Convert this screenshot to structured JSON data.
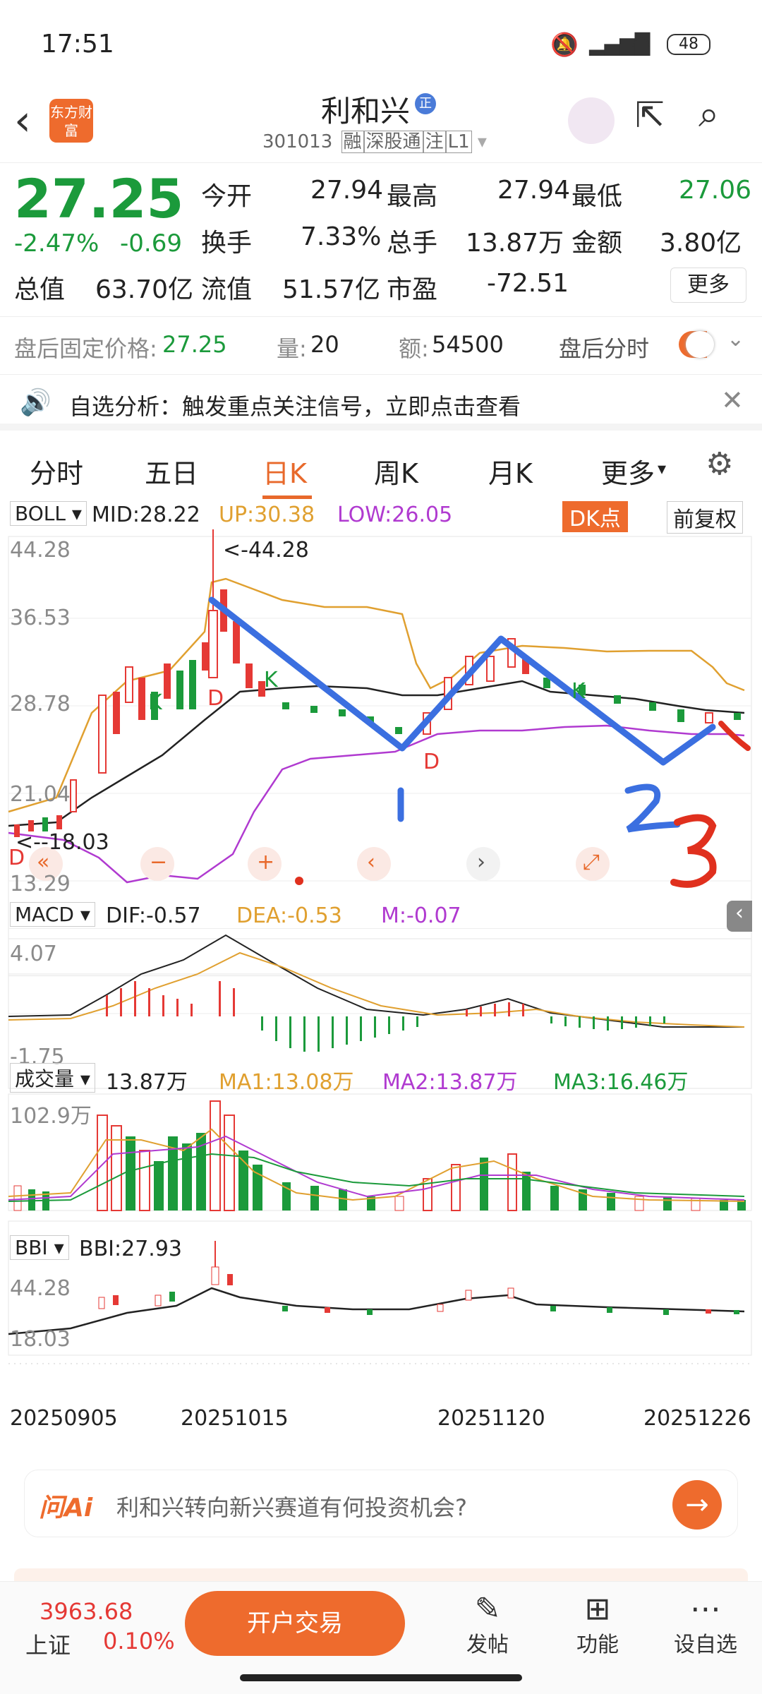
{
  "status": {
    "time": "17:51",
    "battery": "48"
  },
  "header": {
    "title": "利和兴",
    "code": "301013",
    "tags": [
      "融",
      "深股通",
      "注",
      "L1"
    ],
    "logo_text": "东方财富"
  },
  "quote": {
    "price": "27.25",
    "change_pct": "-2.47%",
    "change": "-0.69",
    "stats": [
      {
        "label": "今开",
        "value": "27.94"
      },
      {
        "label": "最高",
        "value": "27.94"
      },
      {
        "label": "最低",
        "value": "27.06"
      },
      {
        "label": "换手",
        "value": "7.33%"
      },
      {
        "label": "总手",
        "value": "13.87万"
      },
      {
        "label": "金额",
        "value": "3.80亿"
      },
      {
        "label": "总值",
        "value": "63.70亿"
      },
      {
        "label": "流值",
        "value": "51.57亿"
      },
      {
        "label": "市盈",
        "value": "-72.51"
      }
    ],
    "more": "更多"
  },
  "afterhours": {
    "price_label": "盘后固定价格:",
    "price": "27.25",
    "vol_label": "量:",
    "vol": "20",
    "amt_label": "额:",
    "amt": "54500",
    "toggle_label": "盘后分时"
  },
  "notice": {
    "text": "自选分析：触发重点关注信号，立即点击查看"
  },
  "tabs": [
    "分时",
    "五日",
    "日K",
    "周K",
    "月K",
    "更多"
  ],
  "boll": {
    "name": "BOLL",
    "mid": "MID:28.22",
    "up": "UP:30.38",
    "low": "LOW:26.05",
    "dk": "DK点",
    "fq": "前复权",
    "y_high": "44.28",
    "y2": "36.53",
    "y3": "28.78",
    "y4": "21.04",
    "y_low": "13.29",
    "max_note": "<-44.28",
    "min_note": "<--18.03",
    "markers": [
      "K",
      "D",
      "K",
      "D",
      "K",
      "D"
    ],
    "handwritten": [
      "1",
      "2",
      "3"
    ]
  },
  "macd": {
    "name": "MACD",
    "dif": "DIF:-0.57",
    "dea": "DEA:-0.53",
    "m": "M:-0.07",
    "y_high": "4.07",
    "y_low": "-1.75"
  },
  "volume": {
    "name": "成交量",
    "value": "13.87万",
    "ma1": "MA1:13.08万",
    "ma2": "MA2:13.87万",
    "ma3": "MA3:16.46万",
    "y_high": "102.9万"
  },
  "bbi": {
    "name": "BBI",
    "value": "BBI:27.93",
    "y_high": "44.28",
    "y_low": "18.03"
  },
  "dates": [
    "20250905",
    "20251015",
    "20251120",
    "20251226"
  ],
  "ask": {
    "brand": "问Ai",
    "text": "利和兴转向新兴赛道有何投资机会?"
  },
  "bottom": {
    "index_value": "3963.68",
    "index_name": "上证",
    "index_change": "0.10%",
    "trade": "开户交易",
    "nav": [
      "发帖",
      "功能",
      "设自选"
    ]
  },
  "colors": {
    "accent": "#e8692b",
    "up": "#e53935",
    "down": "#1b9a3b",
    "mid": "#222222",
    "upper": "#e0a030",
    "lower": "#b03ad0"
  }
}
